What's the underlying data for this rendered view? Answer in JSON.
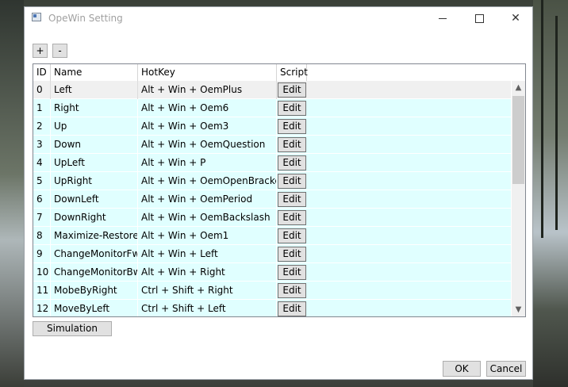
{
  "window": {
    "title": "OpeWin Setting"
  },
  "toolbar": {
    "add_label": "+",
    "remove_label": "-"
  },
  "grid": {
    "columns": [
      "ID",
      "Name",
      "HotKey",
      "Script"
    ],
    "edit_label": "Edit",
    "rows": [
      {
        "id": "0",
        "name": "Left",
        "hotkey": "Alt + Win +  OemPlus"
      },
      {
        "id": "1",
        "name": "Right",
        "hotkey": "Alt + Win +  Oem6"
      },
      {
        "id": "2",
        "name": "Up",
        "hotkey": "Alt + Win +  Oem3"
      },
      {
        "id": "3",
        "name": "Down",
        "hotkey": "Alt + Win +  OemQuestion"
      },
      {
        "id": "4",
        "name": "UpLeft",
        "hotkey": "Alt + Win +  P"
      },
      {
        "id": "5",
        "name": "UpRight",
        "hotkey": "Alt + Win +  OemOpenBrackets"
      },
      {
        "id": "6",
        "name": "DownLeft",
        "hotkey": "Alt + Win +  OemPeriod"
      },
      {
        "id": "7",
        "name": "DownRight",
        "hotkey": "Alt + Win +  OemBackslash"
      },
      {
        "id": "8",
        "name": "Maximize-Restore",
        "hotkey": "Alt + Win +  Oem1"
      },
      {
        "id": "9",
        "name": "ChangeMonitorFw",
        "hotkey": "Alt + Win +  Left"
      },
      {
        "id": "10",
        "name": "ChangeMonitorBw",
        "hotkey": "Alt + Win +  Right"
      },
      {
        "id": "11",
        "name": "MobeByRight",
        "hotkey": "Ctrl + Shift +  Right"
      },
      {
        "id": "12",
        "name": "MoveByLeft",
        "hotkey": "Ctrl + Shift +  Left"
      }
    ],
    "selected_row": 0
  },
  "footer": {
    "simulation_label": "Simulation",
    "ok_label": "OK",
    "cancel_label": "Cancel"
  },
  "colors": {
    "row_background": "#e0ffff",
    "selected_row_background": "#f0f0f0"
  }
}
